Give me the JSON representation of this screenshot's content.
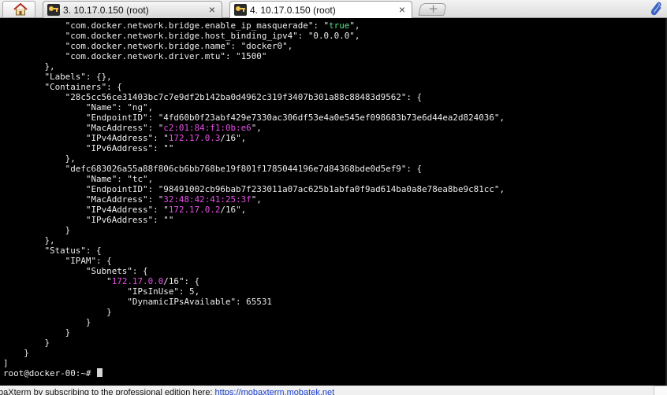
{
  "tabs": [
    {
      "label": "3. 10.17.0.150 (root)",
      "close": "×"
    },
    {
      "label": "4. 10.17.0.150 (root)",
      "close": "×"
    }
  ],
  "new_tab_label": "+",
  "terminal": {
    "lines": [
      [
        {
          "t": "            \"com.docker.network.bridge.enable_ip_masquerade\": \""
        },
        {
          "t": "true",
          "c": "grn"
        },
        {
          "t": "\","
        }
      ],
      [
        {
          "t": "            \"com.docker.network.bridge.host_binding_ipv4\": \"0.0.0.0\","
        }
      ],
      [
        {
          "t": "            \"com.docker.network.bridge.name\": \"docker0\","
        }
      ],
      [
        {
          "t": "            \"com.docker.network.driver.mtu\": \"1500\""
        }
      ],
      [
        {
          "t": "        },"
        }
      ],
      [
        {
          "t": "        \"Labels\": {},"
        }
      ],
      [
        {
          "t": "        \"Containers\": {"
        }
      ],
      [
        {
          "t": "            \"28c5cc56ce31403bc7c7e9df2b142ba0d4962c319f3407b301a88c88483d9562\": {"
        }
      ],
      [
        {
          "t": "                \"Name\": \"ng\","
        }
      ],
      [
        {
          "t": "                \"EndpointID\": \"4fd60b0f23abf429e7330ac306df53e4a0e545ef098683b73e6d44ea2d824036\","
        }
      ],
      [
        {
          "t": "                \"MacAddress\": \""
        },
        {
          "t": "c2:01:84:f1:0b:e6",
          "c": "mag"
        },
        {
          "t": "\","
        }
      ],
      [
        {
          "t": "                \"IPv4Address\": \""
        },
        {
          "t": "172.17.0.3",
          "c": "mag"
        },
        {
          "t": "/16\","
        }
      ],
      [
        {
          "t": "                \"IPv6Address\": \"\""
        }
      ],
      [
        {
          "t": "            },"
        }
      ],
      [
        {
          "t": "            \"defc683026a55a88f806cb6bb768be19f801f1785044196e7d84368bde0d5ef9\": {"
        }
      ],
      [
        {
          "t": "                \"Name\": \"tc\","
        }
      ],
      [
        {
          "t": "                \"EndpointID\": \"98491002cb96bab7f233011a07ac625b1abfa0f9ad614ba0a8e78ea8be9c81cc\","
        }
      ],
      [
        {
          "t": "                \"MacAddress\": \""
        },
        {
          "t": "32:48:42:41:25:3f",
          "c": "mag"
        },
        {
          "t": "\","
        }
      ],
      [
        {
          "t": "                \"IPv4Address\": \""
        },
        {
          "t": "172.17.0.2",
          "c": "mag"
        },
        {
          "t": "/16\","
        }
      ],
      [
        {
          "t": "                \"IPv6Address\": \"\""
        }
      ],
      [
        {
          "t": "            }"
        }
      ],
      [
        {
          "t": "        },"
        }
      ],
      [
        {
          "t": "        \"Status\": {"
        }
      ],
      [
        {
          "t": "            \"IPAM\": {"
        }
      ],
      [
        {
          "t": "                \"Subnets\": {"
        }
      ],
      [
        {
          "t": "                    \""
        },
        {
          "t": "172.17.0.0",
          "c": "mag"
        },
        {
          "t": "/16\": {"
        }
      ],
      [
        {
          "t": "                        \"IPsInUse\": 5,"
        }
      ],
      [
        {
          "t": "                        \"DynamicIPsAvailable\": 65531"
        }
      ],
      [
        {
          "t": "                    }"
        }
      ],
      [
        {
          "t": "                }"
        }
      ],
      [
        {
          "t": "            }"
        }
      ],
      [
        {
          "t": "        }"
        }
      ],
      [
        {
          "t": "    }"
        }
      ],
      [
        {
          "t": "]"
        }
      ],
      [
        {
          "t": "root@docker-00:~# "
        },
        {
          "t": "",
          "c": "cursor"
        }
      ]
    ]
  },
  "status": {
    "message": "baXterm by subscribing to the professional edition here: ",
    "link": "https://mobaxterm.mobatek.net"
  },
  "colors": {
    "magenta": "#e64fe6",
    "green": "#55e38b",
    "terminal_bg": "#000000",
    "terminal_fg": "#e6e6e6"
  }
}
